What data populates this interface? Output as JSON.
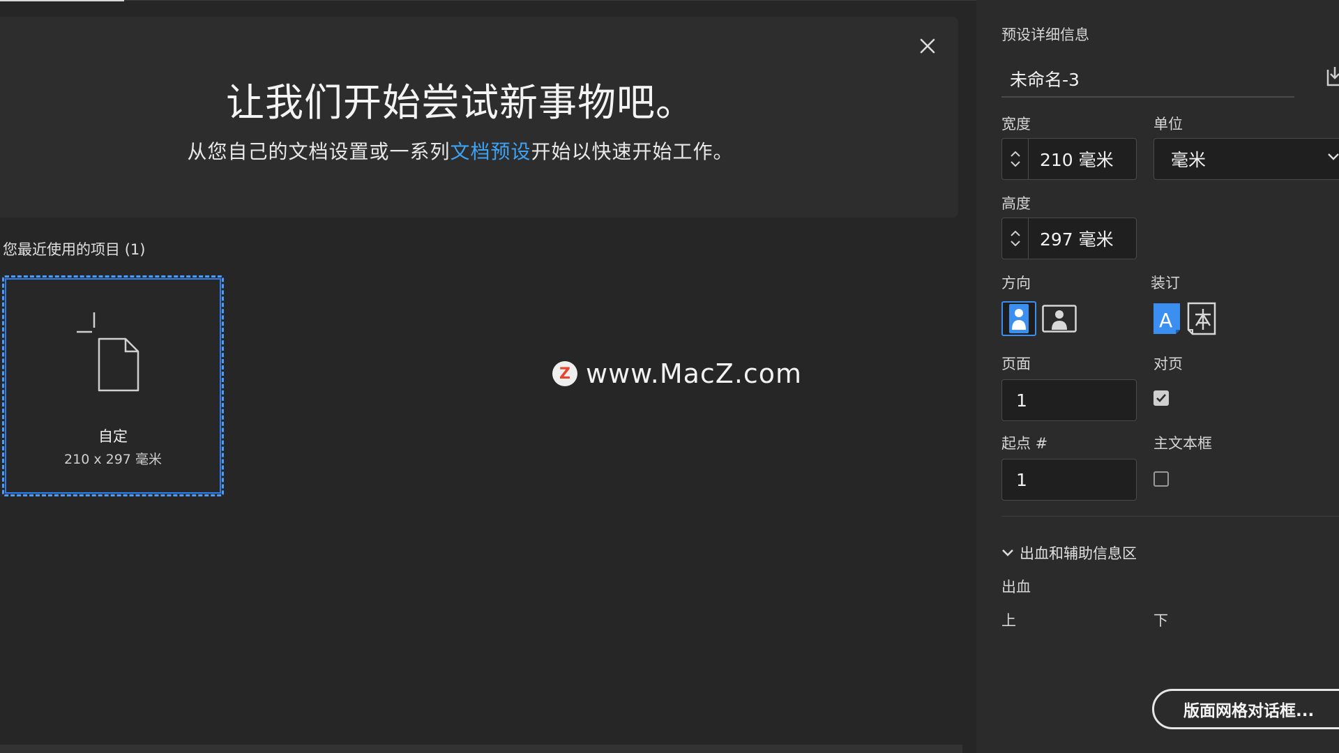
{
  "hero": {
    "title": "让我们开始尝试新事物吧。",
    "subtitle_before": "从您自己的文档设置或一系列",
    "subtitle_link": "文档预设",
    "subtitle_after": "开始以快速开始工作。"
  },
  "recent": {
    "label": "您最近使用的项目",
    "count": "(1)",
    "items": [
      {
        "name": "自定",
        "size": "210 x 297 毫米"
      }
    ]
  },
  "watermark": {
    "logo": "Z",
    "text": "www.MacZ.com"
  },
  "panel": {
    "title": "预设详细信息",
    "doc_name": "未命名-3",
    "width_label": "宽度",
    "width_value": "210 毫米",
    "unit_label": "单位",
    "unit_value": "毫米",
    "height_label": "高度",
    "height_value": "297 毫米",
    "orientation_label": "方向",
    "binding_label": "装订",
    "pages_label": "页面",
    "pages_value": "1",
    "facing_label": "对页",
    "facing_checked": true,
    "start_label": "起点 #",
    "start_value": "1",
    "primary_frame_label": "主文本框",
    "primary_frame_checked": false,
    "bleed_section_label": "出血和辅助信息区",
    "bleed_label": "出血",
    "top_label": "上",
    "bottom_label": "下",
    "grid_button_label": "版面网格对话框..."
  },
  "colors": {
    "accent": "#3a8ff0",
    "link": "#3ea2f5",
    "background": "#262626",
    "panel": "#2b2b2b"
  }
}
